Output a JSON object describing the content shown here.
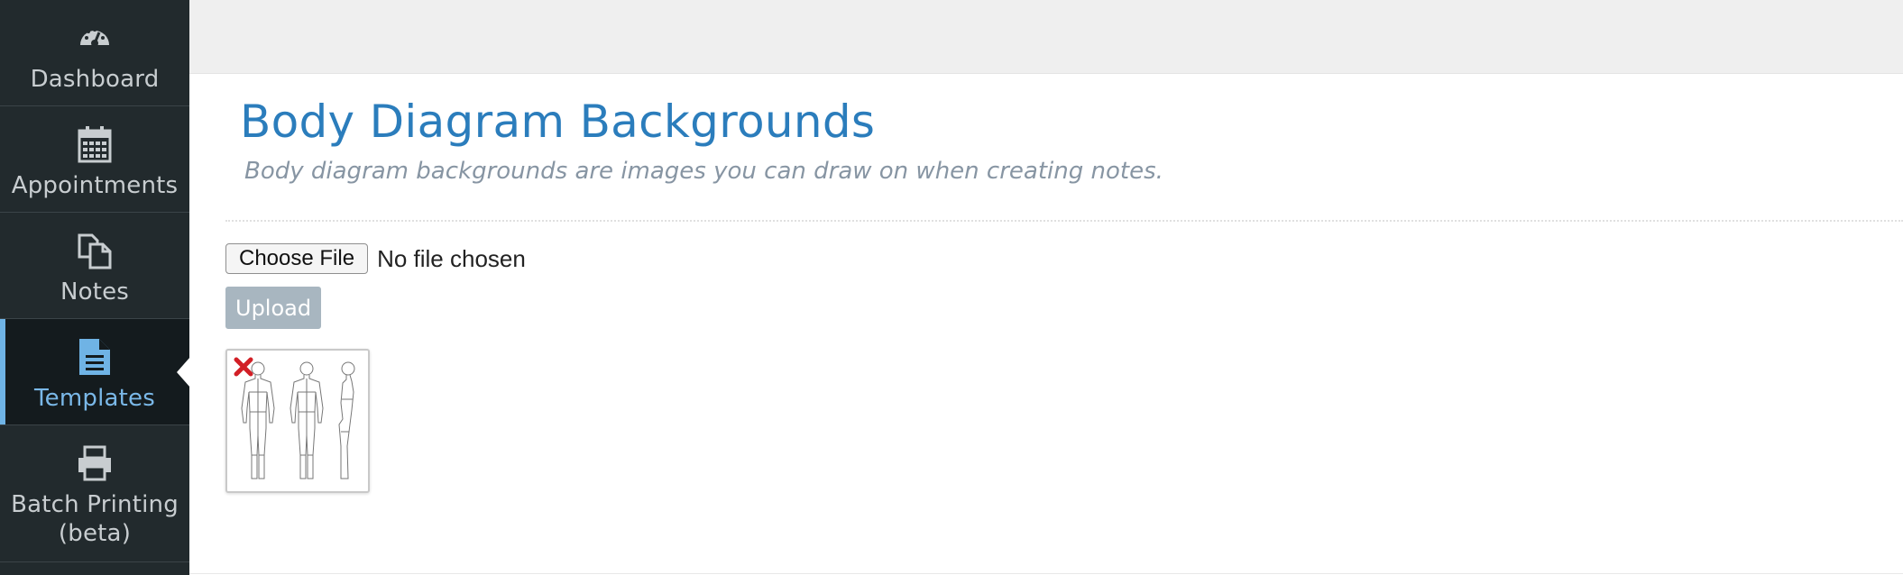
{
  "sidebar": {
    "items": [
      {
        "label": "Dashboard",
        "icon": "dashboard-icon",
        "active": false
      },
      {
        "label": "Appointments",
        "icon": "calendar-icon",
        "active": false
      },
      {
        "label": "Notes",
        "icon": "notes-icon",
        "active": false
      },
      {
        "label": "Templates",
        "icon": "file-text-icon",
        "active": true
      },
      {
        "label": "Batch Printing",
        "label2": "(beta)",
        "icon": "print-icon",
        "active": false
      }
    ]
  },
  "main": {
    "title": "Body Diagram Backgrounds",
    "subtitle": "Body diagram backgrounds are images you can draw on when creating notes.",
    "file_input": {
      "button_label": "Choose File",
      "status": "No file chosen"
    },
    "upload_label": "Upload"
  },
  "colors": {
    "sidebar_bg": "#222a2d",
    "active_accent": "#6fb3e5",
    "title_blue": "#2b7dbc",
    "delete_red": "#d21f26"
  }
}
